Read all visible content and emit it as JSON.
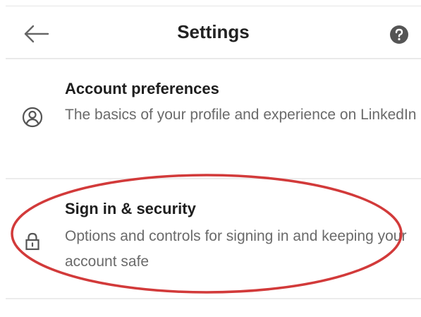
{
  "header": {
    "title": "Settings",
    "back_icon": "arrow-left-icon",
    "help_icon": "question-circle-icon"
  },
  "rows": [
    {
      "title": "Account preferences",
      "description": "The basics of your profile and experience on LinkedIn",
      "icon": "user-circle-icon"
    },
    {
      "title": "Sign in & security",
      "description": "Options and controls for signing in and keeping your account safe",
      "icon": "lock-icon"
    }
  ],
  "annotation": {
    "color": "#d23a3a",
    "shape": "ellipse"
  },
  "colors": {
    "title_text": "#222222",
    "description_text": "#6a6a6a",
    "divider": "#e9e9e9"
  }
}
